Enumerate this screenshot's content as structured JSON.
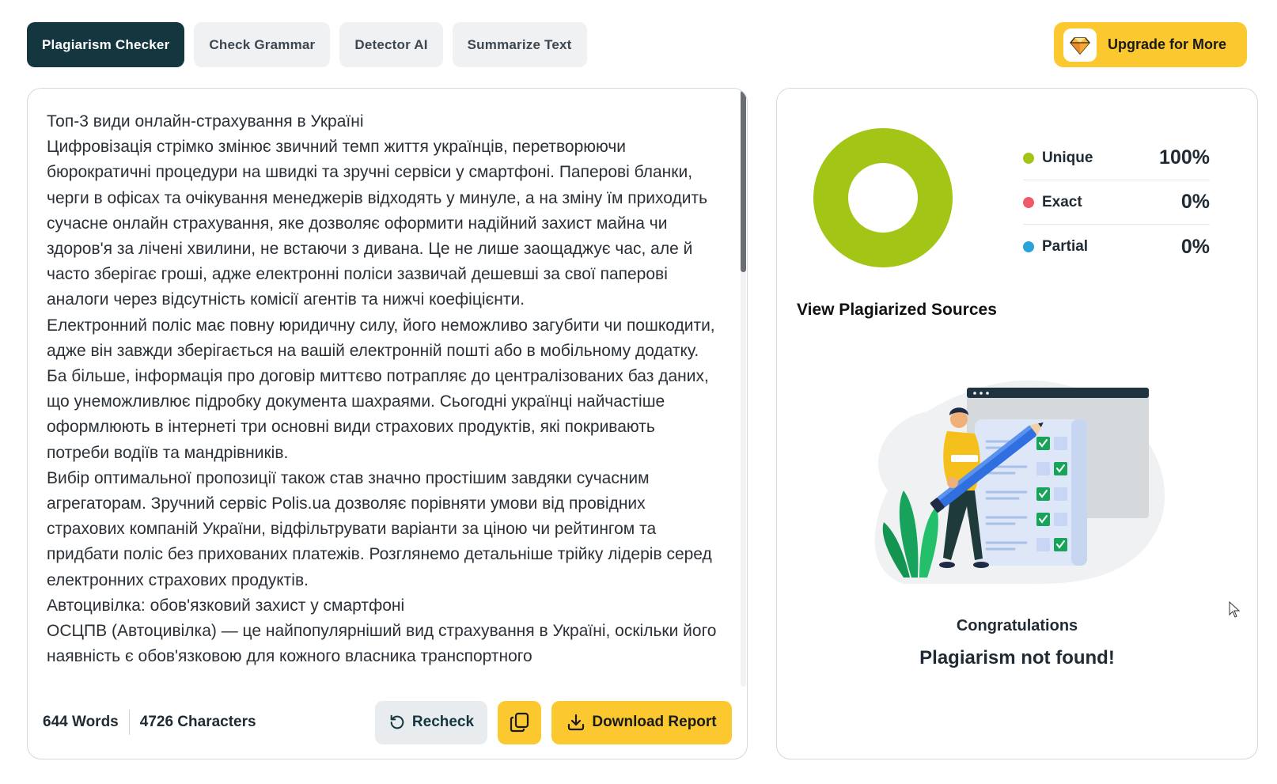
{
  "tabs": [
    {
      "label": "Plagiarism Checker",
      "active": true
    },
    {
      "label": "Check Grammar",
      "active": false
    },
    {
      "label": "Detector AI",
      "active": false
    },
    {
      "label": "Summarize Text",
      "active": false
    }
  ],
  "upgrade": {
    "label": "Upgrade for More",
    "icon": "diamond-icon"
  },
  "editor": {
    "paragraphs": [
      "Топ-3 види онлайн-страхування в Україні",
      "Цифровізація стрімко змінює звичний темп життя українців, перетворюючи бюрократичні процедури на швидкі та зручні сервіси у смартфоні. Паперові бланки, черги в офісах та очікування менеджерів відходять у минуле, а на зміну їм приходить сучасне онлайн страхування, яке дозволяє оформити надійний захист майна чи здоров'я за лічені хвилини, не встаючи з дивана. Це не лише заощаджує час, але й часто зберігає гроші, адже електронні поліси зазвичай дешевші за свої паперові аналоги через відсутність комісії агентів та нижчі коефіцієнти.",
      "Електронний поліс має повну юридичну силу, його неможливо загубити чи пошкодити, адже він завжди зберігається на вашій електронній пошті або в мобільному додатку. Ба більше, інформація про договір миттєво потрапляє до централізованих баз даних, що унеможливлює підробку документа шахраями. Сьогодні українці найчастіше оформлюють в інтернеті три основні види страхових продуктів, які покривають потреби водіїв та мандрівників.",
      "Вибір оптимальної пропозиції також став значно простішим завдяки сучасним агрегаторам. Зручний сервіс Polis.ua дозволяє порівняти умови від провідних страхових компаній України, відфільтрувати варіанти за ціною чи рейтингом та придбати поліс без прихованих платежів. Розглянемо детальніше трійку лідерів серед електронних страхових продуктів.",
      "Автоцивілка: обов'язковий захист у смартфоні",
      "ОСЦПВ (Автоцивілка) — це найпопулярніший вид страхування в Україні, оскільки його наявність є обов'язковою для кожного власника транспортного"
    ],
    "words": "644 Words",
    "characters": "4726 Characters",
    "recheck_label": "Recheck",
    "download_label": "Download Report"
  },
  "results": {
    "legend": [
      {
        "name": "Unique",
        "value": "100%",
        "color": "#a3c516"
      },
      {
        "name": "Exact",
        "value": "0%",
        "color": "#ef5a6a"
      },
      {
        "name": "Partial",
        "value": "0%",
        "color": "#2aa3d6"
      }
    ],
    "unique_fraction": 1.0,
    "sources_title": "View Plagiarized Sources",
    "congrats": "Congratulations",
    "not_found": "Plagiarism not found!"
  },
  "colors": {
    "accent": "#fbc92f",
    "active_tab": "#14363f",
    "unique": "#a3c516"
  }
}
